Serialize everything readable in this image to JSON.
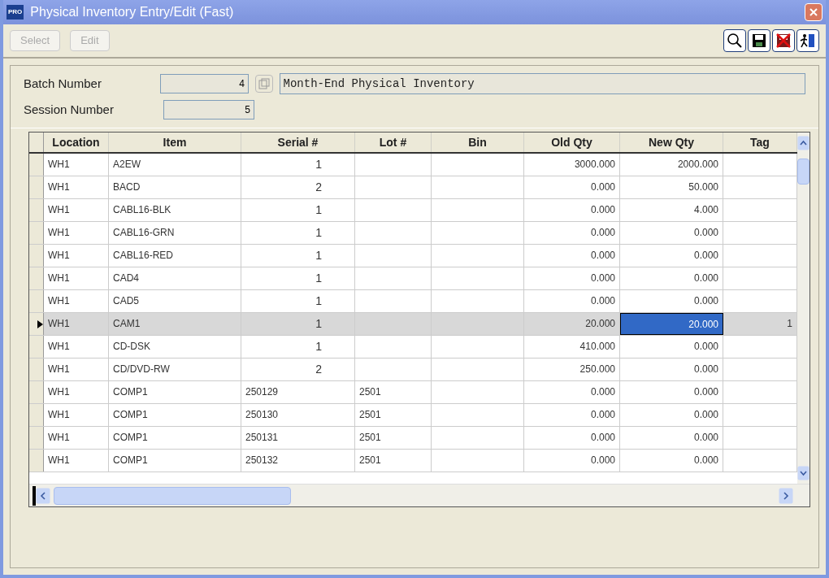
{
  "window": {
    "title": "Physical Inventory Entry/Edit (Fast)",
    "app_badge": "PRO"
  },
  "toolbar": {
    "buttons": [
      {
        "label": "Select",
        "disabled": true
      },
      {
        "label": "Edit",
        "disabled": true
      }
    ]
  },
  "form": {
    "batch_label": "Batch Number",
    "batch_number": "4",
    "batch_description": "Month-End Physical Inventory",
    "session_label": "Session Number",
    "session_number": "5"
  },
  "table": {
    "columns": [
      "Location",
      "Item",
      "Serial #",
      "Lot #",
      "Bin",
      "Old Qty",
      "New Qty",
      "Tag"
    ],
    "rows": [
      {
        "location": "WH1",
        "item": "A2EW",
        "serial": "1",
        "lot": "",
        "bin": "",
        "old_qty": "3000.000",
        "new_qty": "2000.000",
        "tag": "",
        "selected": false
      },
      {
        "location": "WH1",
        "item": "BACD",
        "serial": "2",
        "lot": "",
        "bin": "",
        "old_qty": "0.000",
        "new_qty": "50.000",
        "tag": "",
        "selected": false
      },
      {
        "location": "WH1",
        "item": "CABL16-BLK",
        "serial": "1",
        "lot": "",
        "bin": "",
        "old_qty": "0.000",
        "new_qty": "4.000",
        "tag": "",
        "selected": false
      },
      {
        "location": "WH1",
        "item": "CABL16-GRN",
        "serial": "1",
        "lot": "",
        "bin": "",
        "old_qty": "0.000",
        "new_qty": "0.000",
        "tag": "",
        "selected": false
      },
      {
        "location": "WH1",
        "item": "CABL16-RED",
        "serial": "1",
        "lot": "",
        "bin": "",
        "old_qty": "0.000",
        "new_qty": "0.000",
        "tag": "",
        "selected": false
      },
      {
        "location": "WH1",
        "item": "CAD4",
        "serial": "1",
        "lot": "",
        "bin": "",
        "old_qty": "0.000",
        "new_qty": "0.000",
        "tag": "",
        "selected": false
      },
      {
        "location": "WH1",
        "item": "CAD5",
        "serial": "1",
        "lot": "",
        "bin": "",
        "old_qty": "0.000",
        "new_qty": "0.000",
        "tag": "",
        "selected": false
      },
      {
        "location": "WH1",
        "item": "CAM1",
        "serial": "1",
        "lot": "",
        "bin": "",
        "old_qty": "20.000",
        "new_qty": "20.000",
        "tag": "1",
        "selected": true
      },
      {
        "location": "WH1",
        "item": "CD-DSK",
        "serial": "1",
        "lot": "",
        "bin": "",
        "old_qty": "410.000",
        "new_qty": "0.000",
        "tag": "",
        "selected": false
      },
      {
        "location": "WH1",
        "item": "CD/DVD-RW",
        "serial": "2",
        "lot": "",
        "bin": "",
        "old_qty": "250.000",
        "new_qty": "0.000",
        "tag": "",
        "selected": false
      },
      {
        "location": "WH1",
        "item": "COMP1",
        "serial": "250129",
        "lot": "2501",
        "bin": "",
        "old_qty": "0.000",
        "new_qty": "0.000",
        "tag": "",
        "selected": false
      },
      {
        "location": "WH1",
        "item": "COMP1",
        "serial": "250130",
        "lot": "2501",
        "bin": "",
        "old_qty": "0.000",
        "new_qty": "0.000",
        "tag": "",
        "selected": false
      },
      {
        "location": "WH1",
        "item": "COMP1",
        "serial": "250131",
        "lot": "2501",
        "bin": "",
        "old_qty": "0.000",
        "new_qty": "0.000",
        "tag": "",
        "selected": false
      },
      {
        "location": "WH1",
        "item": "COMP1",
        "serial": "250132",
        "lot": "2501",
        "bin": "",
        "old_qty": "0.000",
        "new_qty": "0.000",
        "tag": "",
        "selected": false
      }
    ]
  }
}
